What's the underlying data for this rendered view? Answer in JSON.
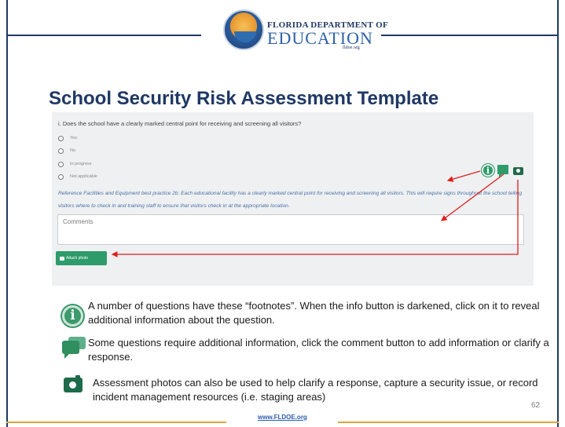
{
  "logo": {
    "line1": "FLORIDA DEPARTMENT OF",
    "line2": "EDUCATION",
    "line3": "fldoe.org"
  },
  "title": "School Security Risk Assessment Template",
  "panel": {
    "question": "i. Does the school have a clearly marked central point for receiving and screening all visitors?",
    "options": [
      "Yes",
      "No",
      "In progress",
      "Not applicable"
    ],
    "reference_text": "Reference Facilities and Equipment best practice 2b: Each educational facility has a clearly marked central point for receiving and screening all visitors. This will require signs throughout the school telling visitors where to check in and training staff to ensure that visitors check in at the appropriate location.",
    "comments_placeholder": "Comments",
    "attach_photo_label": "Attach photo",
    "icons": [
      "info-icon",
      "comment-icon",
      "camera-icon"
    ]
  },
  "legend": {
    "info_text": "A number of questions have these “footnotes”. When the info button is darkened, click on it to reveal additional information about the question.",
    "comment_text": "Some questions require additional information, click the comment button to add information or clarify a response.",
    "camera_text": "Assessment photos can also be used to help clarify a response, capture a security issue, or record incident management resources (i.e. staging areas)"
  },
  "footer": {
    "url": "www.FLDOE.org",
    "page_number": "62"
  },
  "colors": {
    "title": "#1f3864",
    "accent_green": "#2e9b6b",
    "arrow_red": "#e0201c",
    "footer_line": "#e2a33a",
    "link": "#2a5db0"
  }
}
